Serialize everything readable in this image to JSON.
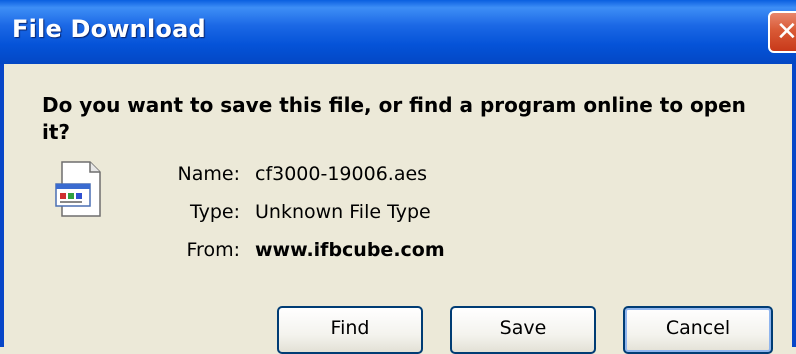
{
  "dialog": {
    "title": "File Download",
    "question": "Do you want to save this file, or find a program online to open it?",
    "file_icon": "document-icon",
    "details": [
      {
        "label": "Name:",
        "value": "cf3000-19006.aes",
        "bold": false
      },
      {
        "label": "Type:",
        "value": "Unknown File Type",
        "bold": false
      },
      {
        "label": "From:",
        "value": "www.ifbcube.com",
        "bold": true
      }
    ],
    "buttons": {
      "find": "Find",
      "save": "Save",
      "cancel": "Cancel"
    }
  }
}
